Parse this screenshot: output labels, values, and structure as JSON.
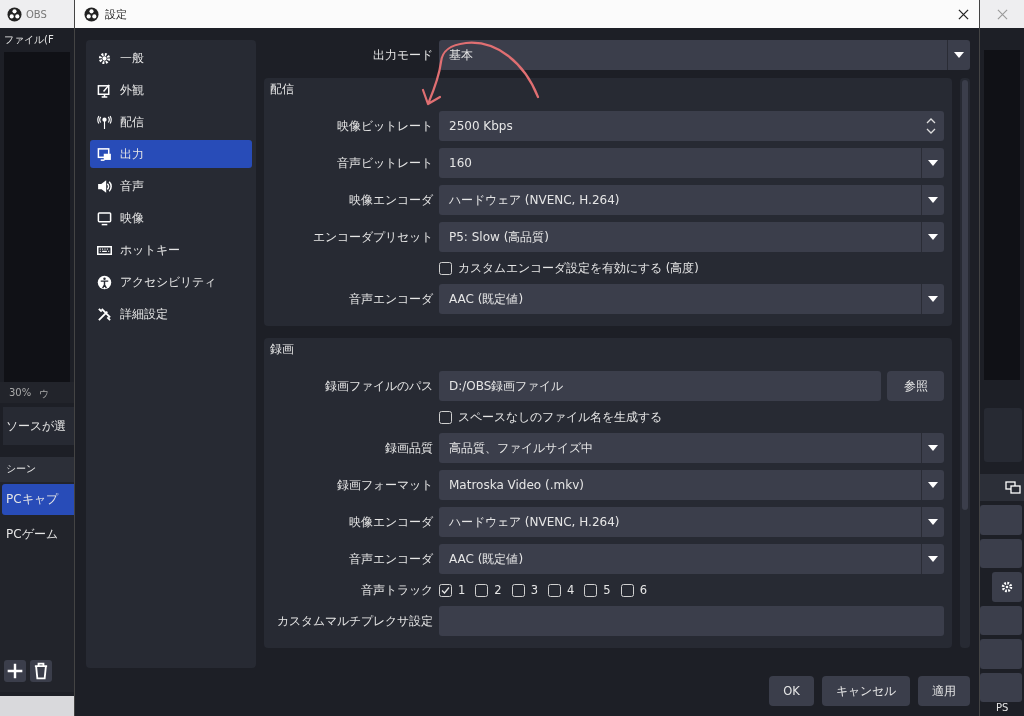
{
  "background_window": {
    "title": "OBS",
    "menu": "ファイル(F",
    "zoom": "30%",
    "zoom_cut": "ウ",
    "source_notice": "ソースが選",
    "scenes_title": "シーン",
    "scenes": [
      {
        "label": "PCキャプ",
        "selected": true
      },
      {
        "label": "PCゲーム",
        "selected": false
      }
    ],
    "status_text": "PS"
  },
  "dialog": {
    "title": "設定"
  },
  "sidebar": [
    {
      "label": "一般",
      "selected": false
    },
    {
      "label": "外観",
      "selected": false
    },
    {
      "label": "配信",
      "selected": false
    },
    {
      "label": "出力",
      "selected": true
    },
    {
      "label": "音声",
      "selected": false
    },
    {
      "label": "映像",
      "selected": false
    },
    {
      "label": "ホットキー",
      "selected": false
    },
    {
      "label": "アクセシビリティ",
      "selected": false
    },
    {
      "label": "詳細設定",
      "selected": false
    }
  ],
  "output_mode": {
    "label": "出力モード",
    "value": "基本"
  },
  "sections": [
    {
      "title": "配信",
      "rows": [
        {
          "kind": "spin",
          "label": "映像ビットレート",
          "value": "2500 Kbps"
        },
        {
          "kind": "select",
          "label": "音声ビットレート",
          "value": "160"
        },
        {
          "kind": "select",
          "label": "映像エンコーダ",
          "value": "ハードウェア (NVENC, H.264)"
        },
        {
          "kind": "select",
          "label": "エンコーダプリセット",
          "value": "P5: Slow (高品質)"
        },
        {
          "kind": "checkbox",
          "label": "カスタムエンコーダ設定を有効にする (高度)",
          "checked": false
        },
        {
          "kind": "select",
          "label": "音声エンコーダ",
          "value": "AAC (既定値)"
        }
      ]
    },
    {
      "title": "録画",
      "rows": [
        {
          "kind": "path",
          "label": "録画ファイルのパス",
          "value": "D:/OBS録画ファイル",
          "button": "参照"
        },
        {
          "kind": "checkbox",
          "label": "スペースなしのファイル名を生成する",
          "checked": false
        },
        {
          "kind": "select",
          "label": "録画品質",
          "value": "高品質、ファイルサイズ中"
        },
        {
          "kind": "select",
          "label": "録画フォーマット",
          "value": "Matroska Video (.mkv)"
        },
        {
          "kind": "select",
          "label": "映像エンコーダ",
          "value": "ハードウェア (NVENC, H.264)"
        },
        {
          "kind": "select",
          "label": "音声エンコーダ",
          "value": "AAC (既定値)"
        },
        {
          "kind": "tracks",
          "label": "音声トラック",
          "tracks": [
            {
              "label": "1",
              "checked": true
            },
            {
              "label": "2",
              "checked": false
            },
            {
              "label": "3",
              "checked": false
            },
            {
              "label": "4",
              "checked": false
            },
            {
              "label": "5",
              "checked": false
            },
            {
              "label": "6",
              "checked": false
            }
          ]
        },
        {
          "kind": "text",
          "label": "カスタムマルチプレクサ設定"
        }
      ]
    }
  ],
  "buttons": [
    "OK",
    "キャンセル",
    "適用"
  ]
}
